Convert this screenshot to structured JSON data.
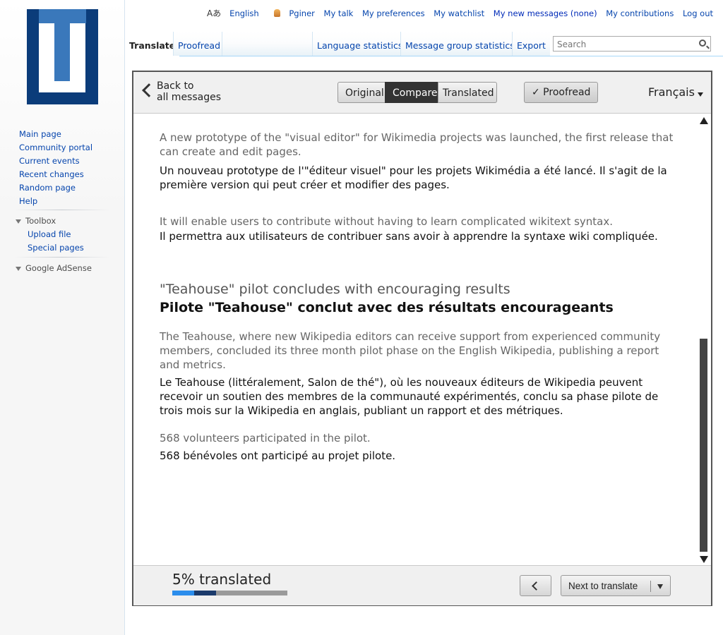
{
  "personal_tools": {
    "language": "English",
    "user": "Pginer",
    "my_talk": "My talk",
    "my_preferences": "My preferences",
    "my_watchlist": "My watchlist",
    "my_new_messages": "My new messages (none)",
    "my_contributions": "My contributions",
    "log_out": "Log out"
  },
  "tabs": {
    "translate": "Translate",
    "proofread": "Proofread",
    "language_statistics": "Language statistics",
    "message_group_statistics": "Message group statistics",
    "export": "Export"
  },
  "search": {
    "placeholder": "Search"
  },
  "sidebar": {
    "navigation": [
      "Main page",
      "Community portal",
      "Current events",
      "Recent changes",
      "Random page",
      "Help"
    ],
    "toolbox_heading": "Toolbox",
    "toolbox": [
      "Upload file",
      "Special pages"
    ],
    "adsense_heading": "Google AdSense"
  },
  "panel": {
    "back_line1": "Back to",
    "back_line2": "all messages",
    "view_modes": [
      "Original",
      "Compare",
      "Translated"
    ],
    "active_view_mode": "Compare",
    "proofread_button": "✓ Proofread",
    "language": "Français"
  },
  "messages": [
    {
      "source": "A new prototype of the \"visual editor\" for Wikimedia projects was launched, the first release that can create and edit pages.",
      "translation": "Un nouveau prototype de l'\"éditeur visuel\" pour les projets Wikimédia a été lancé. Il s'agit de la première version qui peut créer et modifier des pages."
    },
    {
      "source": "It will enable users to contribute without having to learn complicated wikitext syntax.",
      "translation": "Il permettra aux utilisateurs de contribuer sans avoir à apprendre la syntaxe wiki compliquée."
    },
    {
      "source": "\"Teahouse\" pilot concludes with encouraging results",
      "translation": "Pilote \"Teahouse\" conclut avec des résultats encourageants",
      "heading": true
    },
    {
      "source": "The Teahouse, where new Wikipedia editors can receive support from experienced community members, concluded its three month pilot phase on the English Wikipedia, publishing a report and metrics.",
      "translation": "Le Teahouse (littéralement, Salon de thé\"), où les nouveaux éditeurs de Wikipedia peuvent recevoir un soutien des membres de la communauté expérimentés, conclu sa phase pilote de trois mois sur la Wikipedia en anglais, publiant un rapport et des métriques."
    },
    {
      "source": "568 volunteers participated in the pilot.",
      "translation": "568 bénévoles ont participé au projet pilote."
    }
  ],
  "footer": {
    "progress_label": "5% translated",
    "progress": {
      "translated_fraction": 0.19,
      "proofread_fraction": 0.19
    },
    "next_button": "Next to translate"
  },
  "colors": {
    "link": "#0645ad",
    "progress_translated": "#2b8dec",
    "progress_proofread": "#1b3a6b",
    "logo_dark": "#0b3c7a",
    "logo_light": "#3a78bb"
  }
}
